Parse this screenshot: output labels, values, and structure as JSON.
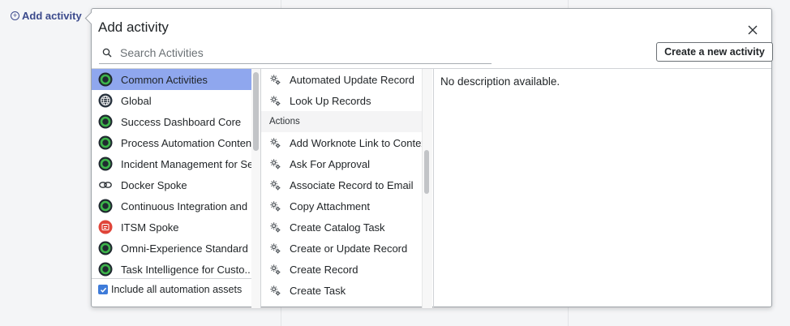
{
  "page": {
    "add_activity_link": "Add activity"
  },
  "popover": {
    "title": "Add activity",
    "search": {
      "placeholder": "Search Activities",
      "value": ""
    },
    "create_button": "Create a new activity",
    "close_icon": "close-icon"
  },
  "categories": [
    {
      "label": "Common Activities",
      "icon": "green-ring-icon",
      "selected": true
    },
    {
      "label": "Global",
      "icon": "globe-icon",
      "selected": false
    },
    {
      "label": "Success Dashboard Core",
      "icon": "green-ring-icon",
      "selected": false
    },
    {
      "label": "Process Automation Content",
      "icon": "green-ring-icon",
      "selected": false
    },
    {
      "label": "Incident Management for Service",
      "icon": "green-ring-icon",
      "selected": false
    },
    {
      "label": "Docker Spoke",
      "icon": "docker-chain-icon",
      "selected": false
    },
    {
      "label": "Continuous Integration and",
      "icon": "green-ring-icon",
      "selected": false
    },
    {
      "label": "ITSM Spoke",
      "icon": "itsm-red-icon",
      "selected": false
    },
    {
      "label": "Omni-Experience Standard",
      "icon": "green-ring-icon",
      "selected": false
    },
    {
      "label": "Task Intelligence for Custo..",
      "icon": "green-ring-icon",
      "selected": false
    }
  ],
  "include_all_assets": {
    "label": "Include all automation assets",
    "checked": true
  },
  "activities_top": [
    {
      "label": "Automated Update Record",
      "icon": "gear-icon"
    },
    {
      "label": "Look Up Records",
      "icon": "gear-icon"
    }
  ],
  "actions_header": "Actions",
  "actions": [
    {
      "label": "Add Worknote Link to Context",
      "icon": "gear-icon"
    },
    {
      "label": "Ask For Approval",
      "icon": "gear-icon"
    },
    {
      "label": "Associate Record to Email",
      "icon": "gear-icon"
    },
    {
      "label": "Copy Attachment",
      "icon": "gear-icon"
    },
    {
      "label": "Create Catalog Task",
      "icon": "gear-icon"
    },
    {
      "label": "Create or Update Record",
      "icon": "gear-icon"
    },
    {
      "label": "Create Record",
      "icon": "gear-icon"
    },
    {
      "label": "Create Task",
      "icon": "gear-icon"
    }
  ],
  "description": "No description available.",
  "colors": {
    "accent_link": "#3b4a8c",
    "selected_row": "#8fa7ee",
    "checkbox": "#3e7bd9",
    "green_ring": "#3db54a",
    "itsm_red": "#e0453a"
  }
}
